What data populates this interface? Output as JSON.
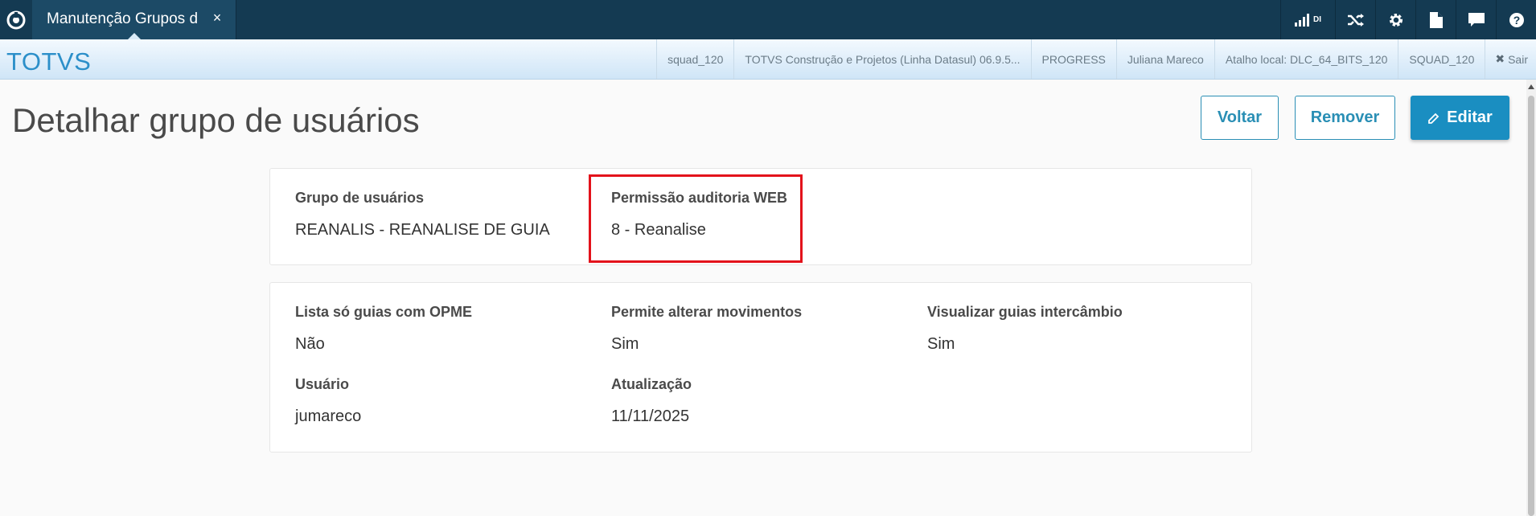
{
  "topbar": {
    "tab_label": "Manutenção Grupos d",
    "tab_close": "×",
    "icons": [
      "signal-icon",
      "shuffle-icon",
      "gear-icon",
      "document-icon",
      "chat-icon",
      "help-icon"
    ],
    "signal_badge": "DI"
  },
  "infobar": {
    "brand": "TOTVS",
    "items": [
      "squad_120",
      "TOTVS Construção e Projetos (Linha Datasul) 06.9.5...",
      "PROGRESS",
      "Juliana Mareco",
      "Atalho local: DLC_64_BITS_120",
      "SQUAD_120"
    ],
    "logout_label": "Sair",
    "logout_icon": "✖"
  },
  "page": {
    "title": "Detalhar grupo de usuários",
    "buttons": {
      "back": "Voltar",
      "remove": "Remover",
      "edit": "Editar"
    }
  },
  "card1": {
    "group_label": "Grupo de usuários",
    "group_value": "REANALIS - REANALISE DE GUIA",
    "permission_label": "Permissão auditoria WEB",
    "permission_value": "8 - Reanalise"
  },
  "card2": {
    "opme_label": "Lista só guias com OPME",
    "opme_value": "Não",
    "alter_label": "Permite alterar movimentos",
    "alter_value": "Sim",
    "interchange_label": "Visualizar guias intercâmbio",
    "interchange_value": "Sim",
    "user_label": "Usuário",
    "user_value": "jumareco",
    "updated_label": "Atualização",
    "updated_value": "11/11/2025"
  },
  "colors": {
    "topbar": "#143a52",
    "brand": "#2c8fc9",
    "primary": "#1a8ec1",
    "highlight": "#e3121b"
  }
}
